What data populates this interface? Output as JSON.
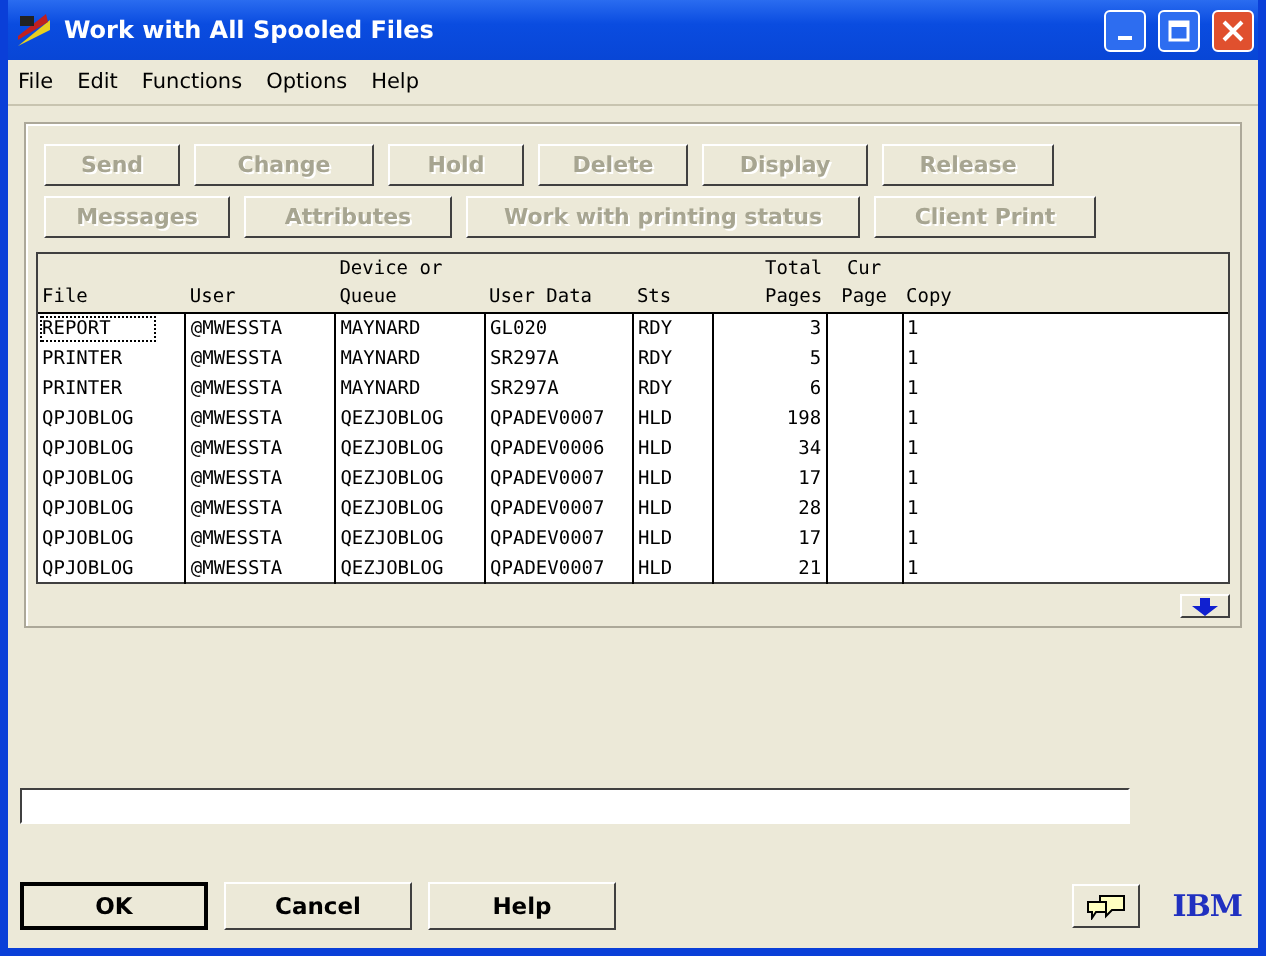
{
  "window": {
    "title": "Work with All Spooled Files"
  },
  "menu": [
    "File",
    "Edit",
    "Functions",
    "Options",
    "Help"
  ],
  "action_buttons": [
    [
      {
        "label": "Send",
        "disabled": true
      },
      {
        "label": "Change",
        "disabled": true
      },
      {
        "label": "Hold",
        "disabled": true
      },
      {
        "label": "Delete",
        "disabled": true
      },
      {
        "label": "Display",
        "disabled": true
      },
      {
        "label": "Release",
        "disabled": true
      }
    ],
    [
      {
        "label": "Messages",
        "disabled": true
      },
      {
        "label": "Attributes",
        "disabled": true
      },
      {
        "label": "Work with printing status",
        "disabled": true
      },
      {
        "label": "Client Print",
        "disabled": true
      }
    ]
  ],
  "table": {
    "columns": [
      {
        "lines": [
          "File"
        ]
      },
      {
        "lines": [
          "User"
        ]
      },
      {
        "lines": [
          "Device or",
          "Queue"
        ]
      },
      {
        "lines": [
          "User Data"
        ]
      },
      {
        "lines": [
          "Sts"
        ]
      },
      {
        "lines": [
          "Total",
          "Pages"
        ]
      },
      {
        "lines": [
          "Cur",
          "Page"
        ]
      },
      {
        "lines": [
          "Copy"
        ]
      }
    ],
    "rows": [
      {
        "focused": true,
        "cells": [
          "REPORT",
          "@MWESSTA",
          "MAYNARD",
          "GL020",
          "RDY",
          "3",
          "",
          "1"
        ]
      },
      {
        "focused": false,
        "cells": [
          "PRINTER",
          "@MWESSTA",
          "MAYNARD",
          "SR297A",
          "RDY",
          "5",
          "",
          "1"
        ]
      },
      {
        "focused": false,
        "cells": [
          "PRINTER",
          "@MWESSTA",
          "MAYNARD",
          "SR297A",
          "RDY",
          "6",
          "",
          "1"
        ]
      },
      {
        "focused": false,
        "cells": [
          "QPJOBLOG",
          "@MWESSTA",
          "QEZJOBLOG",
          "QPADEV0007",
          "HLD",
          "198",
          "",
          "1"
        ]
      },
      {
        "focused": false,
        "cells": [
          "QPJOBLOG",
          "@MWESSTA",
          "QEZJOBLOG",
          "QPADEV0006",
          "HLD",
          "34",
          "",
          "1"
        ]
      },
      {
        "focused": false,
        "cells": [
          "QPJOBLOG",
          "@MWESSTA",
          "QEZJOBLOG",
          "QPADEV0007",
          "HLD",
          "17",
          "",
          "1"
        ]
      },
      {
        "focused": false,
        "cells": [
          "QPJOBLOG",
          "@MWESSTA",
          "QEZJOBLOG",
          "QPADEV0007",
          "HLD",
          "28",
          "",
          "1"
        ]
      },
      {
        "focused": false,
        "cells": [
          "QPJOBLOG",
          "@MWESSTA",
          "QEZJOBLOG",
          "QPADEV0007",
          "HLD",
          "17",
          "",
          "1"
        ]
      },
      {
        "focused": false,
        "cells": [
          "QPJOBLOG",
          "@MWESSTA",
          "QEZJOBLOG",
          "QPADEV0007",
          "HLD",
          "21",
          "",
          "1"
        ]
      }
    ]
  },
  "bottom_buttons": [
    {
      "label": "OK",
      "default": true
    },
    {
      "label": "Cancel",
      "default": false
    },
    {
      "label": "Help",
      "default": false
    }
  ],
  "logo": "IBM"
}
